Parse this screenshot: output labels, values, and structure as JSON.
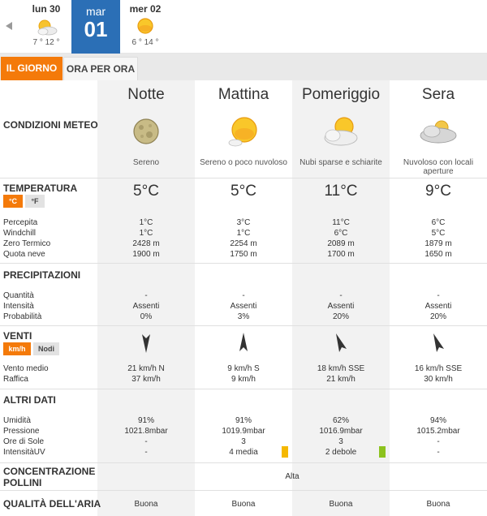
{
  "days": [
    {
      "name": "lun 30",
      "temps": "7 ° 12 °",
      "icon": "sun-cloud-icon"
    },
    {
      "name": "mar",
      "number": "01",
      "active": true
    },
    {
      "name": "mer 02",
      "temps": "6 ° 14 °",
      "icon": "sun-icon"
    }
  ],
  "tabs": {
    "day": "IL GIORNO",
    "hourly": "ORA PER ORA"
  },
  "periods": [
    {
      "title": "Notte",
      "icon": "moon-icon",
      "desc": "Sereno",
      "temp": "5°C",
      "percepita": "1°C",
      "windchill": "1°C",
      "zero_termico": "2428 m",
      "quota_neve": "1900 m",
      "quantita": "-",
      "intensita": "Assenti",
      "probabilita": "0%",
      "vento_medio": "21 km/h  N",
      "raffica": "37 km/h",
      "umidita": "91%",
      "pressione": "1021.8mbar",
      "ore_sole": "-",
      "uv": "-",
      "aria": "Buona"
    },
    {
      "title": "Mattina",
      "icon": "sun-icon",
      "desc": "Sereno o poco nuvoloso",
      "temp": "5°C",
      "percepita": "3°C",
      "windchill": "1°C",
      "zero_termico": "2254 m",
      "quota_neve": "1750 m",
      "quantita": "-",
      "intensita": "Assenti",
      "probabilita": "3%",
      "vento_medio": "9 km/h S",
      "raffica": "9 km/h",
      "umidita": "91%",
      "pressione": "1019.9mbar",
      "ore_sole": "3",
      "uv": "4 media",
      "aria": "Buona"
    },
    {
      "title": "Pomeriggio",
      "icon": "partly-cloudy-icon",
      "desc": "Nubi sparse e schiarite",
      "temp": "11°C",
      "percepita": "11°C",
      "windchill": "6°C",
      "zero_termico": "2089 m",
      "quota_neve": "1700 m",
      "quantita": "-",
      "intensita": "Assenti",
      "probabilita": "20%",
      "vento_medio": "18 km/h SSE",
      "raffica": "21 km/h",
      "umidita": "62%",
      "pressione": "1016.9mbar",
      "ore_sole": "3",
      "uv": "2 debole",
      "aria": "Buona"
    },
    {
      "title": "Sera",
      "icon": "cloudy-icon",
      "desc": "Nuvoloso con locali aperture",
      "temp": "9°C",
      "percepita": "6°C",
      "windchill": "5°C",
      "zero_termico": "1879 m",
      "quota_neve": "1650 m",
      "quantita": "-",
      "intensita": "Assenti",
      "probabilita": "20%",
      "vento_medio": "16 km/h SSE",
      "raffica": "30 km/h",
      "umidita": "94%",
      "pressione": "1015.2mbar",
      "ore_sole": "-",
      "uv": "-",
      "aria": "Buona"
    }
  ],
  "labels": {
    "condizioni": "CONDIZIONI METEO",
    "temperatura": "TEMPERATURA",
    "percepita": "Percepita",
    "windchill": "Windchill",
    "zero_termico": "Zero Termico",
    "quota_neve": "Quota neve",
    "precipitazioni": "PRECIPITAZIONI",
    "quantita": "Quantità",
    "intensita": "Intensità",
    "probabilita": "Probabilità",
    "venti": "VENTI",
    "vento_medio": "Vento medio",
    "raffica": "Raffica",
    "altri_dati": "ALTRI DATI",
    "umidita": "Umidità",
    "pressione": "Pressione",
    "ore_sole": "Ore di Sole",
    "uv": "IntensitàUV",
    "pollini_1": "CONCENTRAZIONE",
    "pollini_2": "POLLINI",
    "aria": "QUALITÀ DELL'ARIA"
  },
  "units": {
    "celsius": "°C",
    "fahrenheit": "°F",
    "kmh": "km/h",
    "knots": "Nodi"
  },
  "pollini_value": "Alta",
  "colors": {
    "accent": "#f47a0a",
    "active_day": "#2b6fb6",
    "uv_media": "#f5b800",
    "uv_debole": "#8cc21e"
  }
}
